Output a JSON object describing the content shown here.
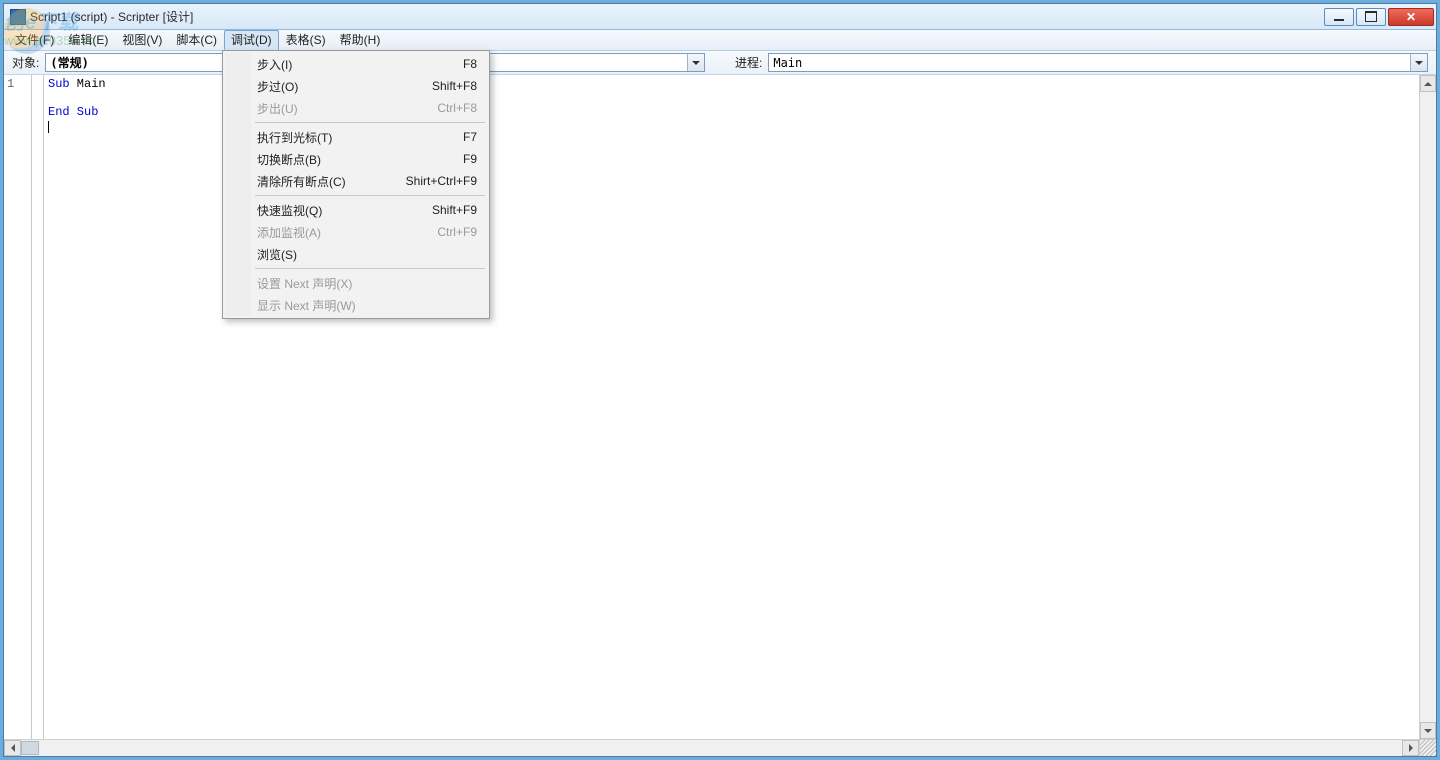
{
  "title": "Script1 (script) - Scripter [设计]",
  "menubar": [
    "文件(F)",
    "编辑(E)",
    "视图(V)",
    "脚本(C)",
    "调试(D)",
    "表格(S)",
    "帮助(H)"
  ],
  "active_menu_index": 4,
  "toolbar": {
    "object_label": "对象:",
    "object_value": "(常规)",
    "proc_label": "进程:",
    "proc_value": "Main"
  },
  "gutter_lines": [
    "1"
  ],
  "code": {
    "line1_kw1": "Sub",
    "line1_rest": " Main",
    "line3_kw": "End Sub"
  },
  "dropdown": {
    "groups": [
      [
        {
          "label": "步入(I)",
          "shortcut": "F8",
          "disabled": false
        },
        {
          "label": "步过(O)",
          "shortcut": "Shift+F8",
          "disabled": false
        },
        {
          "label": "步出(U)",
          "shortcut": "Ctrl+F8",
          "disabled": true
        }
      ],
      [
        {
          "label": "执行到光标(T)",
          "shortcut": "F7",
          "disabled": false
        },
        {
          "label": "切换断点(B)",
          "shortcut": "F9",
          "disabled": false
        },
        {
          "label": "清除所有断点(C)",
          "shortcut": "Shirt+Ctrl+F9",
          "disabled": false
        }
      ],
      [
        {
          "label": "快速监视(Q)",
          "shortcut": "Shift+F9",
          "disabled": false
        },
        {
          "label": "添加监视(A)",
          "shortcut": "Ctrl+F9",
          "disabled": true
        },
        {
          "label": "浏览(S)",
          "shortcut": "",
          "disabled": false
        }
      ],
      [
        {
          "label": "设置 Next 声明(X)",
          "shortcut": "",
          "disabled": true
        },
        {
          "label": "显示 Next 声明(W)",
          "shortcut": "",
          "disabled": true
        }
      ]
    ]
  },
  "watermark": {
    "main": "创e下载",
    "sub": "www.pc0359.cn"
  }
}
